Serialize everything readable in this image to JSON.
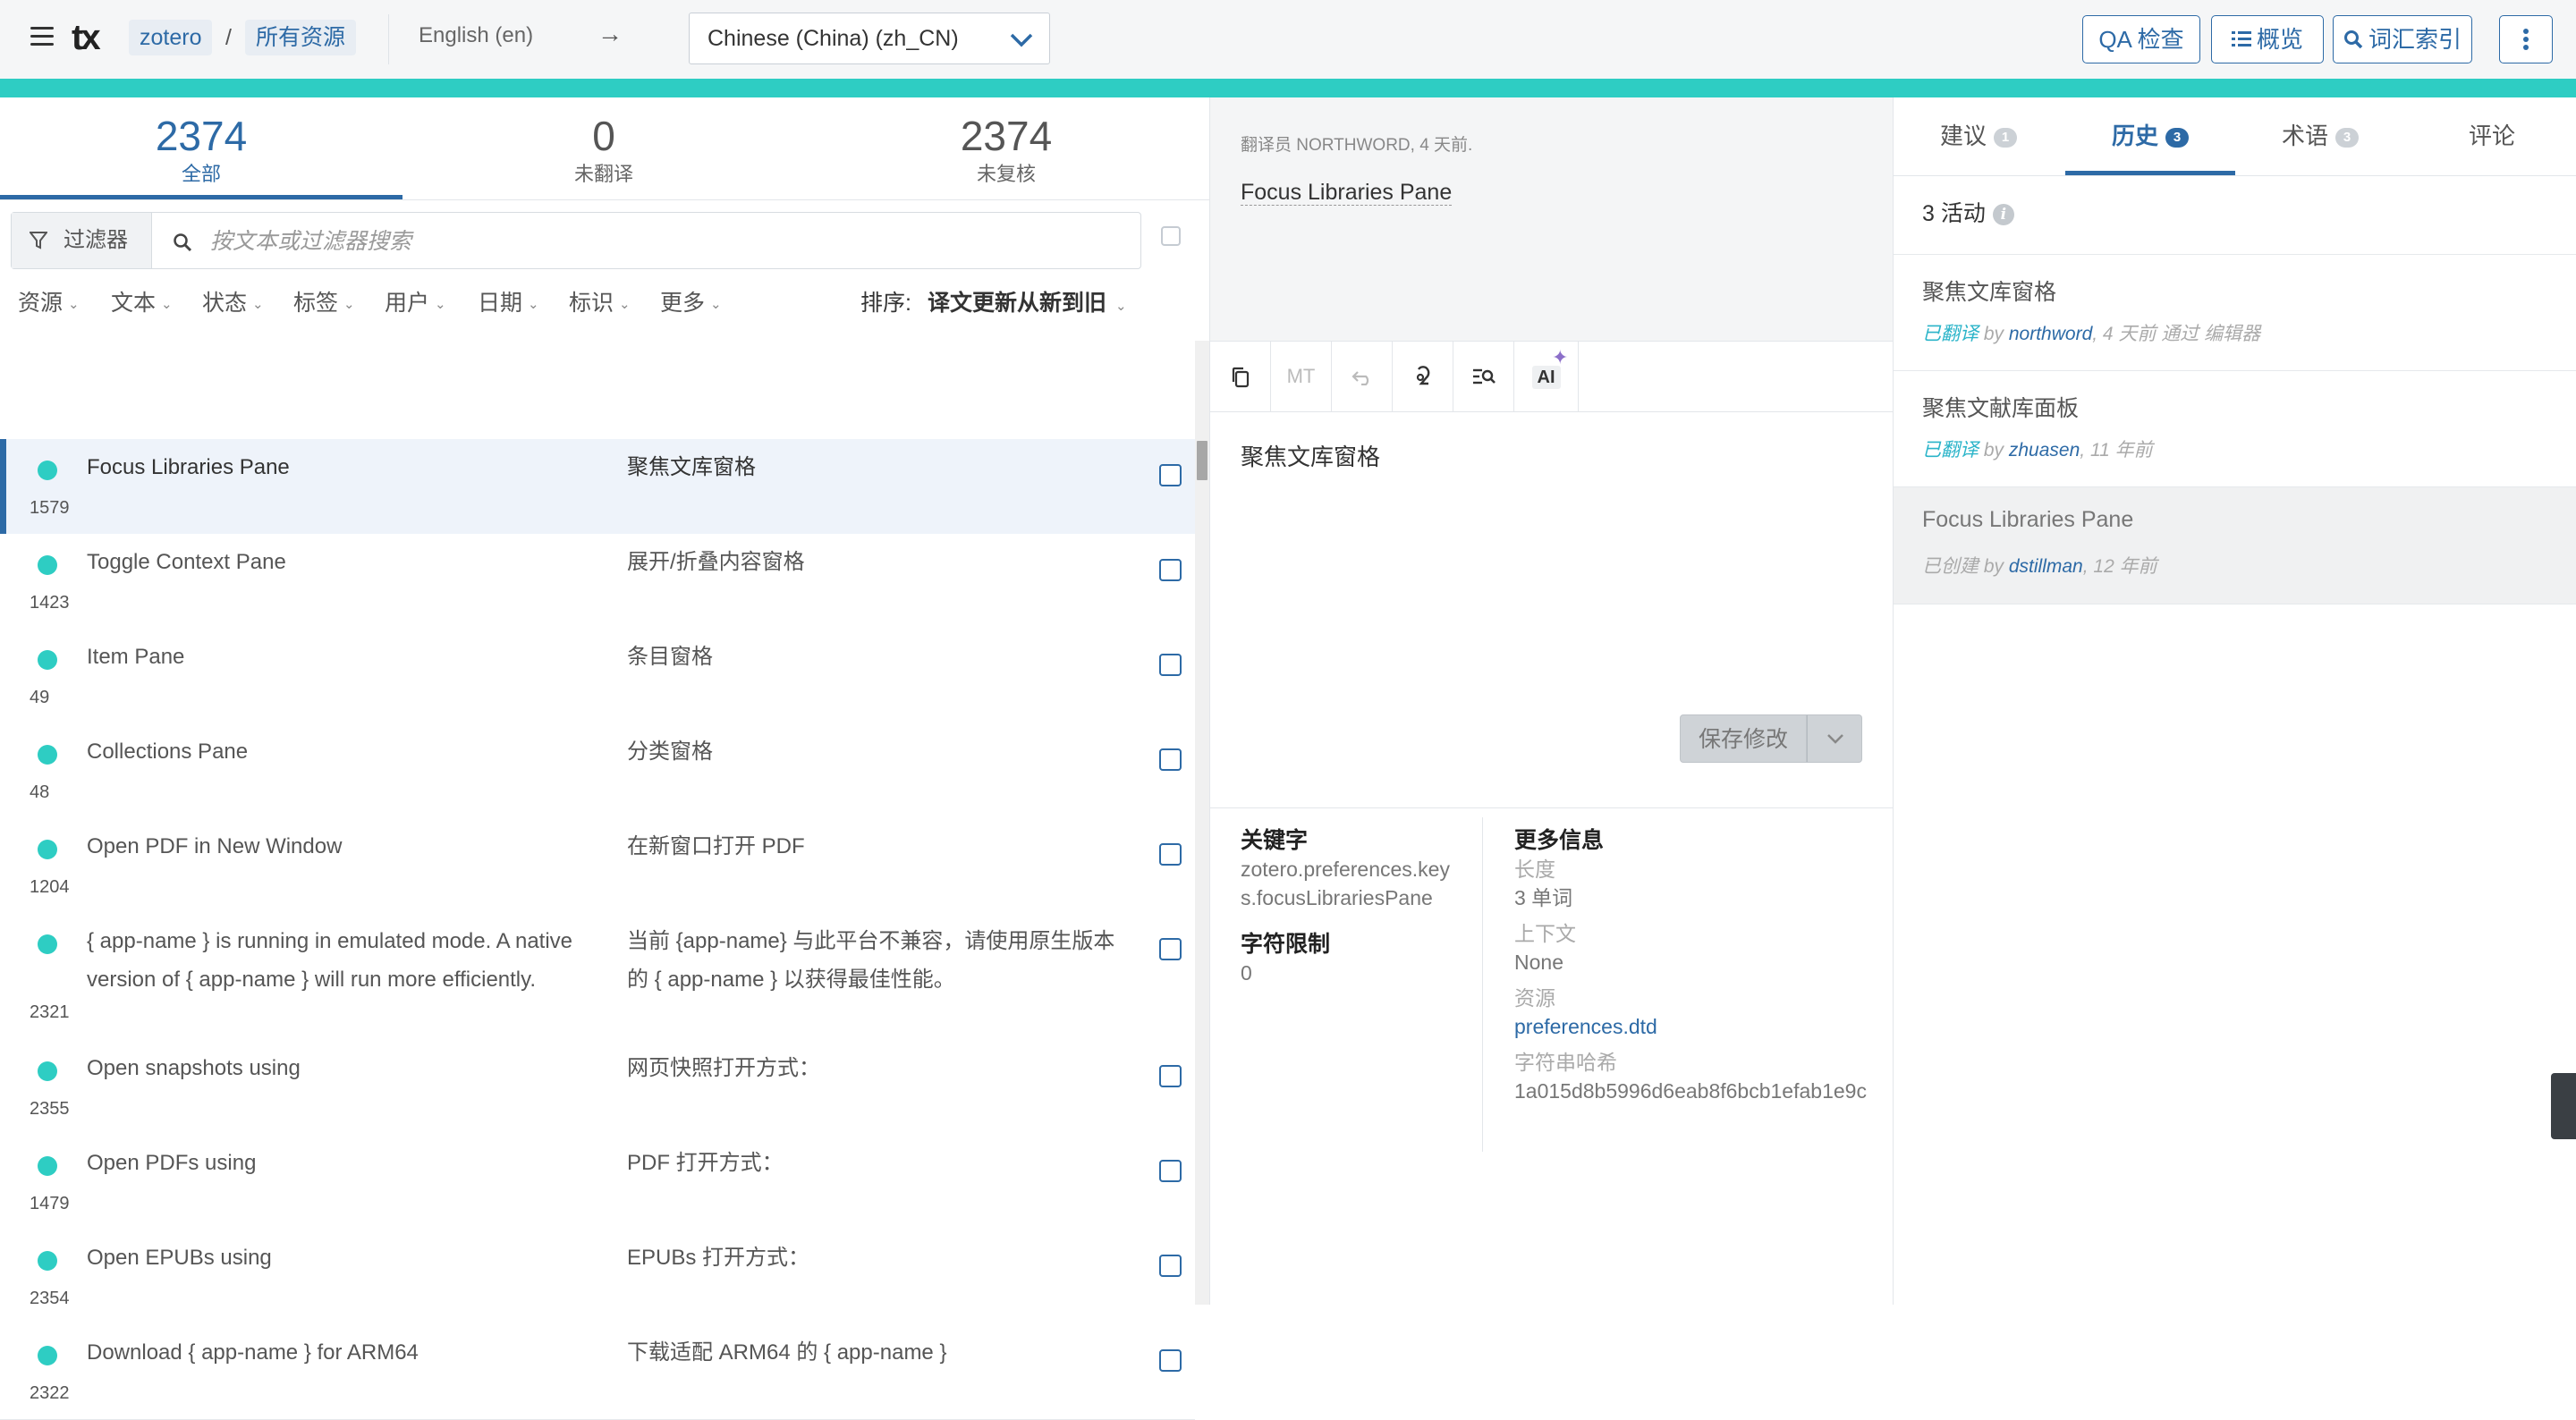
{
  "topbar": {
    "project": "zotero",
    "resource": "所有资源",
    "source_lang": "English (en)",
    "arrow": "→",
    "target_lang": "Chinese (China) (zh_CN)",
    "buttons": {
      "qa": "QA 检查",
      "overview": "概览",
      "glossary": "词汇索引"
    }
  },
  "stats": [
    {
      "num": "2374",
      "label": "全部"
    },
    {
      "num": "0",
      "label": "未翻译"
    },
    {
      "num": "2374",
      "label": "未复核"
    }
  ],
  "filter": {
    "button": "过滤器",
    "placeholder": "按文本或过滤器搜索"
  },
  "facets": [
    "资源",
    "文本",
    "状态",
    "标签",
    "用户",
    "日期",
    "标识",
    "更多"
  ],
  "sort": {
    "label": "排序:",
    "value": "译文更新从新到旧"
  },
  "rows": [
    {
      "id": "1579",
      "source": "Focus Libraries Pane",
      "target": "聚焦文库窗格"
    },
    {
      "id": "1423",
      "source": "Toggle Context Pane",
      "target": "展开/折叠内容窗格"
    },
    {
      "id": "49",
      "source": "Item Pane",
      "target": "条目窗格"
    },
    {
      "id": "48",
      "source": "Collections Pane",
      "target": "分类窗格"
    },
    {
      "id": "1204",
      "source": "Open PDF in New Window",
      "target": "在新窗口打开 PDF"
    },
    {
      "id": "2321",
      "source": "{ app-name } is running in emulated mode. A native version of { app-name } will run more efficiently.",
      "target": "当前 {app-name} 与此平台不兼容，请使用原生版本的 { app-name } 以获得最佳性能。"
    },
    {
      "id": "2355",
      "source": "Open snapshots using",
      "target": "网页快照打开方式："
    },
    {
      "id": "1479",
      "source": "Open PDFs using",
      "target": "PDF 打开方式："
    },
    {
      "id": "2354",
      "source": "Open EPUBs using",
      "target": "EPUBs 打开方式："
    },
    {
      "id": "2322",
      "source": "Download { app-name } for ARM64",
      "target": "下载适配 ARM64 的 { app-name }"
    }
  ],
  "editor": {
    "meta": "翻译员 NORTHWORD, 4 天前.",
    "source_text": "Focus Libraries Pane",
    "tools": {
      "mt": "MT",
      "ai": "AI"
    },
    "translation": "聚焦文库窗格",
    "save": "保存修改"
  },
  "details": {
    "key_title": "关键字",
    "key_value": "zotero.preferences.keys.focusLibrariesPane",
    "charlimit_title": "字符限制",
    "charlimit_value": "0",
    "more_title": "更多信息",
    "length_key": "长度",
    "length_value": "3 单词",
    "context_key": "上下文",
    "context_value": "None",
    "resource_key": "资源",
    "resource_value": "preferences.dtd",
    "hash_key": "字符串哈希",
    "hash_value": "1a015d8b5996d6eab8f6bcb1efab1e9c"
  },
  "right_tabs": [
    {
      "label": "建议",
      "badge": "1"
    },
    {
      "label": "历史",
      "badge": "3"
    },
    {
      "label": "术语",
      "badge": "3"
    },
    {
      "label": "评论",
      "badge": ""
    }
  ],
  "history": {
    "title": "3 活动",
    "items": [
      {
        "text": "聚焦文库窗格",
        "status": "已翻译",
        "by": "by",
        "user": "northword",
        "when": ", 4 天前 通过 编辑器"
      },
      {
        "text": "聚焦文献库面板",
        "status": "已翻译",
        "by": "by",
        "user": "zhuasen",
        "when": ", 11 年前"
      },
      {
        "text": "Focus Libraries Pane",
        "status": "已创建",
        "by": "by",
        "user": "dstillman",
        "when": ", 12 年前"
      }
    ]
  },
  "colors": {
    "accent": "#2ecdc3",
    "primary": "#2d6aa6"
  }
}
